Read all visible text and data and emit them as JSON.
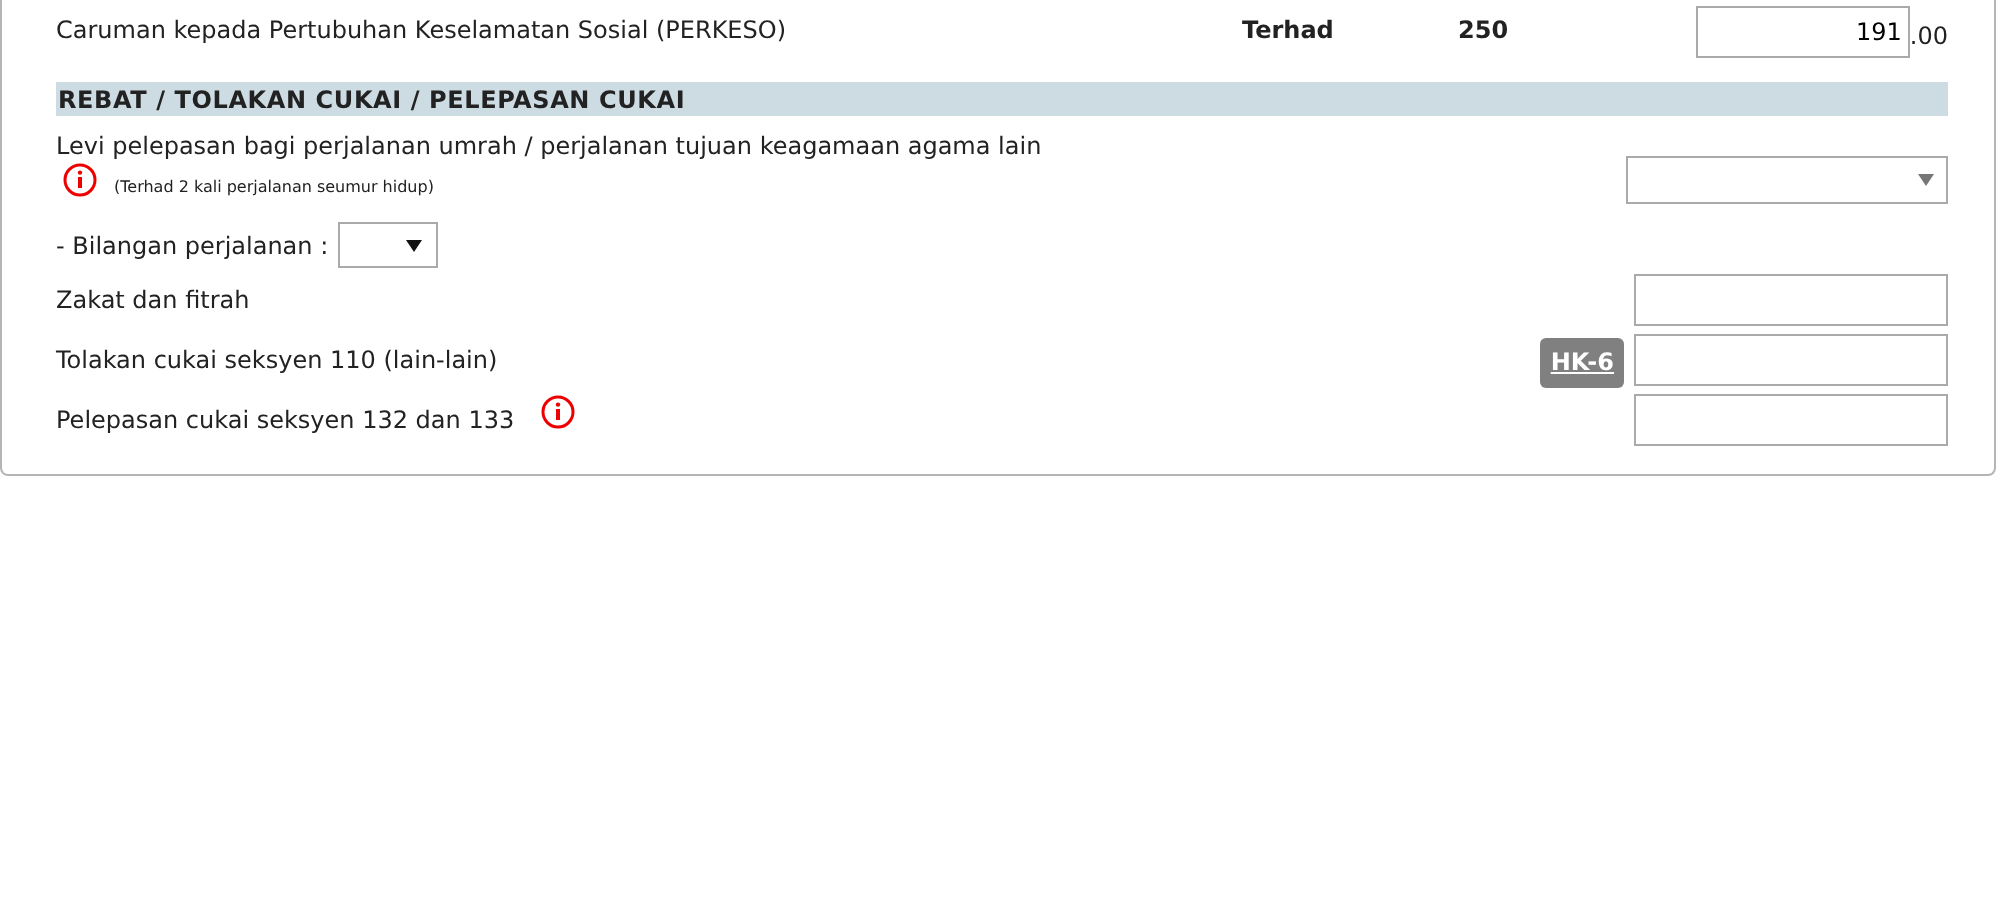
{
  "contribution_row": {
    "label": "Caruman kepada Pertubuhan Keselamatan Sosial (PERKESO)",
    "limit_label": "Terhad",
    "limit": "250",
    "amount": "191",
    "amount_suffix": ".00"
  },
  "section": {
    "title": "REBAT / TOLAKAN CUKAI / PELEPASAN CUKAI"
  },
  "items": [
    {
      "kind": "select",
      "label": "Levi pelepasan bagi perjalanan umrah / perjalanan tujuan keagamaan agama lain",
      "info": true,
      "note": "(Terhad 2 kali perjalanan seumur hidup)"
    },
    {
      "kind": "count-select",
      "label": "- Bilangan perjalanan :",
      "info": false
    },
    {
      "kind": "input",
      "label": "Zakat dan fitrah",
      "info": false
    },
    {
      "kind": "input",
      "label": "Tolakan cukai seksyen 110 (lain-lain)",
      "info": false,
      "button": "HK-6"
    },
    {
      "kind": "input",
      "label": "Pelepasan cukai seksyen 132 dan 133",
      "info": true
    }
  ]
}
